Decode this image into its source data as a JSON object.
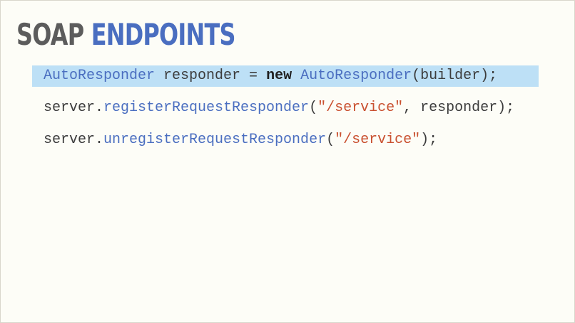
{
  "slide": {
    "title_part1": "SOAP",
    "title_part2": "ENDPOINTS",
    "code": {
      "line1": {
        "type": "AutoResponder",
        "decl": " responder = ",
        "keyword": "new",
        "space": " ",
        "ctor": "AutoResponder",
        "args": "(builder);"
      },
      "line2": {
        "obj": "server.",
        "method": "registerRequestResponder",
        "open": "(",
        "str": "\"/service\"",
        "rest": ", responder);"
      },
      "line3": {
        "obj": "server.",
        "method": "unregisterRequestResponder",
        "open": "(",
        "str": "\"/service\"",
        "rest": ");"
      }
    },
    "colors": {
      "background": "#fdfdf7",
      "title_gray": "#5c5c5c",
      "title_blue": "#4a6ec0",
      "highlight": "#bde0f6",
      "string_red": "#c9502f",
      "identifier_blue": "#4a6ec0"
    }
  }
}
